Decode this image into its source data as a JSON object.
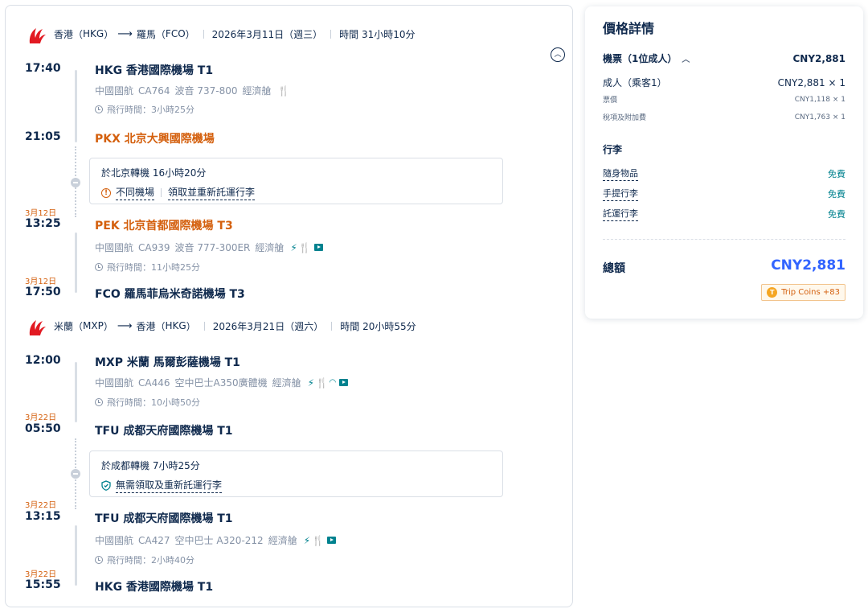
{
  "segments": [
    {
      "from": "香港",
      "from_code": "HKG",
      "to": "羅馬",
      "to_code": "FCO",
      "date": "2026年3月11日",
      "weekday": "週三",
      "duration": "時間 31小時10分",
      "legs": [
        {
          "dep_time": "17:40",
          "dep_date": "",
          "dep_airport": "HKG 香港國際機場 T1",
          "airline": "中國國航",
          "flight_no": "CA764",
          "aircraft": "波音 737-800",
          "cabin": "經濟艙",
          "amenities": [
            "meal"
          ],
          "flight_time": "飛行時間：3小時25分",
          "arr_time": "21:05",
          "arr_date": "",
          "arr_airport": "PKX 北京大興國際機場"
        },
        {
          "dep_time": "13:25",
          "dep_date": "3月12日",
          "dep_airport": "PEK 北京首都國際機場 T3",
          "airline": "中國國航",
          "flight_no": "CA939",
          "aircraft": "波音 777-300ER",
          "cabin": "經濟艙",
          "amenities": [
            "power",
            "meal",
            "tv"
          ],
          "flight_time": "飛行時間：11小時25分",
          "arr_time": "17:50",
          "arr_date": "3月12日",
          "arr_airport": "FCO 羅馬菲烏米奇諾機場 T3"
        }
      ],
      "transfer": {
        "text": "於北京轉機  16小時20分",
        "note1": "不同機場",
        "note2": "領取並重新託運行李"
      }
    },
    {
      "from": "米蘭",
      "from_code": "MXP",
      "to": "香港",
      "to_code": "HKG",
      "date": "2026年3月21日",
      "weekday": "週六",
      "duration": "時間 20小時55分",
      "legs": [
        {
          "dep_time": "12:00",
          "dep_date": "",
          "dep_airport": "MXP 米蘭 馬爾彭薩機場 T1",
          "airline": "中國國航",
          "flight_no": "CA446",
          "aircraft": "空中巴士A350廣體機",
          "cabin": "經濟艙",
          "amenities": [
            "power",
            "meal",
            "wifi",
            "tv"
          ],
          "flight_time": "飛行時間：10小時50分",
          "arr_time": "05:50",
          "arr_date": "3月22日",
          "arr_airport": "TFU 成都天府國際機場 T1"
        },
        {
          "dep_time": "13:15",
          "dep_date": "3月22日",
          "dep_airport": "TFU 成都天府國際機場 T1",
          "airline": "中國國航",
          "flight_no": "CA427",
          "aircraft": "空中巴士 A320-212",
          "cabin": "經濟艙",
          "amenities": [
            "power",
            "meal",
            "tv"
          ],
          "flight_time": "飛行時間：2小時40分",
          "arr_time": "15:55",
          "arr_date": "3月22日",
          "arr_airport": "HKG 香港國際機場 T1"
        }
      ],
      "transfer": {
        "text": "於成都轉機  7小時25分",
        "note1": "無需領取及重新託運行李"
      }
    }
  ],
  "price": {
    "title": "價格詳情",
    "ticket_label": "機票（1位成人）",
    "ticket_total": "CNY2,881",
    "adult_label": "成人（乘客1）",
    "adult_value": "CNY2,881 × 1",
    "fare_label": "票價",
    "fare_value": "CNY1,118 × 1",
    "tax_label": "稅項及附加費",
    "tax_value": "CNY1,763 × 1",
    "baggage_title": "行李",
    "personal_label": "隨身物品",
    "personal_value": "免費",
    "carryon_label": "手提行李",
    "carryon_value": "免費",
    "checked_label": "託運行李",
    "checked_value": "免費",
    "total_label": "總額",
    "total_value": "CNY2,881",
    "coins_label": "Trip Coins +83"
  },
  "colors": {
    "primary_text": "#0f294d",
    "secondary_text": "#8592a6",
    "orange": "#d4600e",
    "teal": "#00828f",
    "blue": "#3264ff",
    "airline_red": "#e21a22"
  },
  "icons": {
    "airline_logo": "air-china-logo",
    "collapse": "chevron-up-circle-icon"
  }
}
